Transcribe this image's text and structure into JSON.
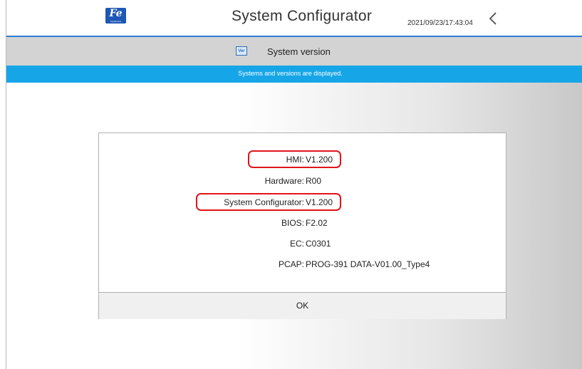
{
  "header": {
    "logo_text": "Fe",
    "logo_subtext": "Fuji Electric",
    "title": "System Configurator",
    "datetime": "2021/09/23/17:43:04",
    "back_icon": "chevron-left-icon"
  },
  "subheader": {
    "icon_text": "Ver",
    "icon": "version-icon",
    "title": "System version"
  },
  "info": {
    "message": "Systems and versions are displayed."
  },
  "dialog": {
    "rows": [
      {
        "label": "HMI:",
        "value": "V1.200",
        "highlighted": true
      },
      {
        "label": "Hardware:",
        "value": "R00",
        "highlighted": false
      },
      {
        "label": "System Configurator:",
        "value": "V1.200",
        "highlighted": true
      },
      {
        "label": "BIOS:",
        "value": "F2.02",
        "highlighted": false
      },
      {
        "label": "EC:",
        "value": "C0301",
        "highlighted": false
      },
      {
        "label": "PCAP:",
        "value": "PROG-391 DATA-V01.00_Type4",
        "highlighted": false
      }
    ],
    "ok_label": "OK"
  },
  "colors": {
    "accent": "#16a6e8",
    "title_underline": "#2a7fd4",
    "highlight": "#e0141b",
    "logo": "#1f57b5"
  }
}
